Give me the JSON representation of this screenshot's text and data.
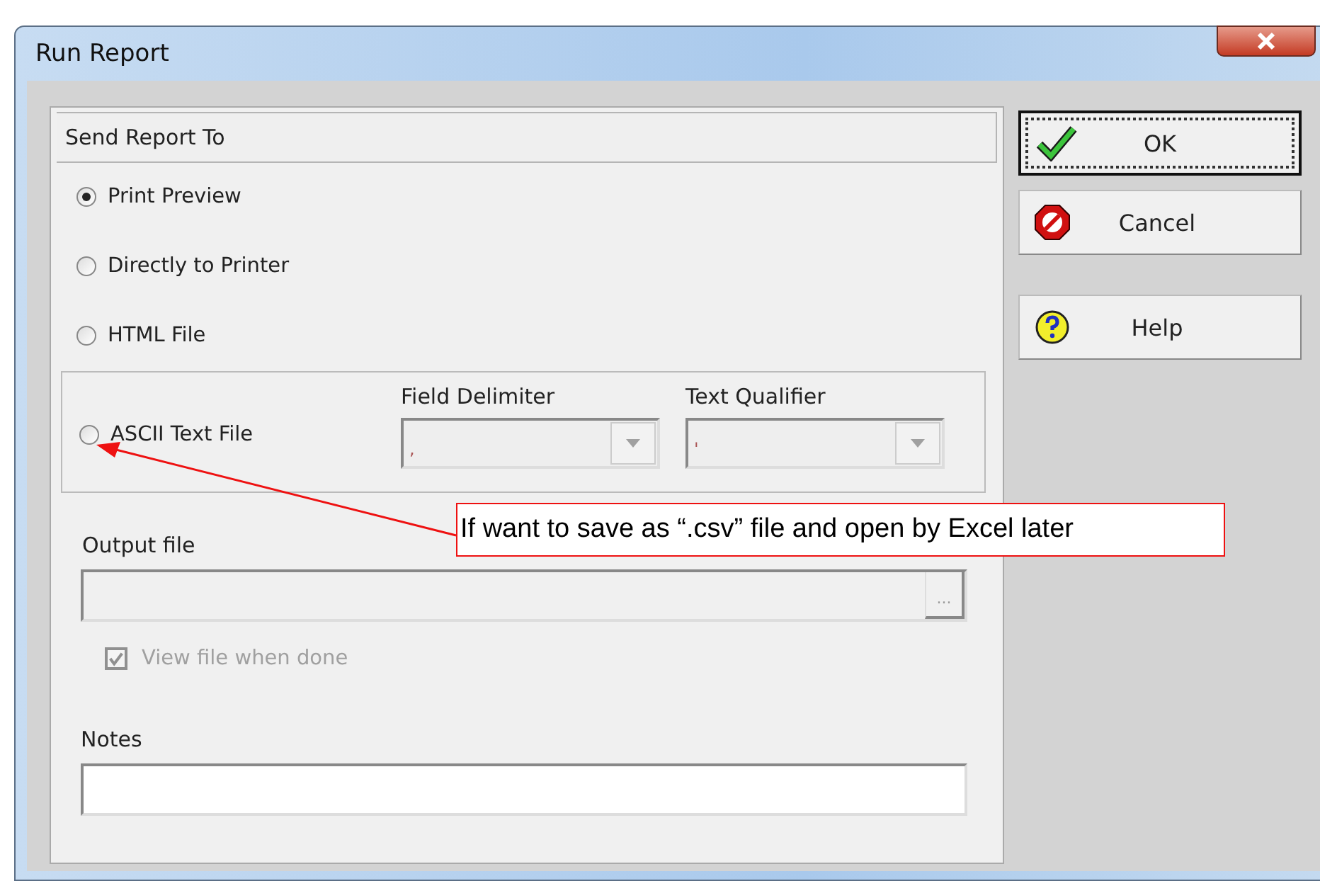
{
  "window": {
    "title": "Run Report"
  },
  "send_report_to": {
    "heading": "Send Report To",
    "options": [
      {
        "label": "Print Preview",
        "selected": true
      },
      {
        "label": "Directly to Printer",
        "selected": false
      },
      {
        "label": "HTML File",
        "selected": false
      },
      {
        "label": "ASCII Text File",
        "selected": false
      }
    ]
  },
  "field_delimiter": {
    "label": "Field Delimiter",
    "value": ",",
    "disabled": true
  },
  "text_qualifier": {
    "label": "Text Qualifier",
    "value": "'",
    "disabled": true
  },
  "output_file": {
    "label": "Output file",
    "browse": "...",
    "disabled": true
  },
  "view_file_when_done": {
    "label": "View file when done",
    "checked": true,
    "disabled": true
  },
  "notes": {
    "label": "Notes"
  },
  "buttons": [
    {
      "label": "OK",
      "kind": "ok",
      "focused": true
    },
    {
      "label": "Cancel",
      "kind": "cancel",
      "focused": false
    },
    {
      "label": "Help",
      "kind": "help",
      "focused": false
    }
  ],
  "annotation": {
    "text": "If want to save as “.csv” file and open by Excel later"
  }
}
